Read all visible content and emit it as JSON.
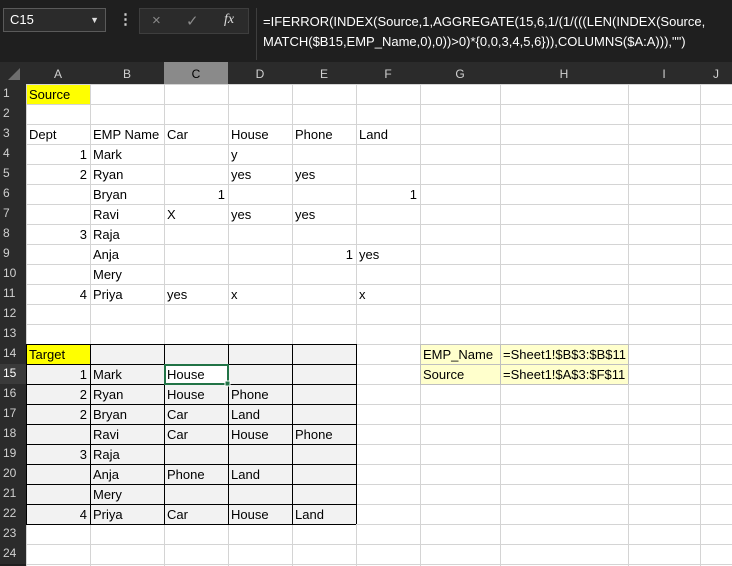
{
  "name_box": {
    "value": "C15"
  },
  "formula_bar": {
    "cancel_icon": "×",
    "enter_icon": "✓",
    "fx_icon": "fx",
    "formula": "=IFERROR(INDEX(Source,1,AGGREGATE(15,6,1/(1/(((LEN(INDEX(Source,\nMATCH($B15,EMP_Name,0),0))>0)*{0,0,3,4,5,6})),COLUMNS($A:A))),\"\")"
  },
  "columns": [
    "A",
    "B",
    "C",
    "D",
    "E",
    "F",
    "G",
    "H",
    "I",
    "J"
  ],
  "rows": [
    "1",
    "2",
    "3",
    "4",
    "5",
    "6",
    "7",
    "8",
    "9",
    "10",
    "11",
    "12",
    "13",
    "14",
    "15",
    "16",
    "17",
    "18",
    "19",
    "20",
    "21",
    "22",
    "23",
    "24"
  ],
  "selected_cell": "C15",
  "colors": {
    "yellow": "#ffff00",
    "light_yellow": "#ffffcc",
    "gray_fill": "#f2f2f2",
    "selection": "#217346"
  },
  "cells": {
    "A1": "Source",
    "A3": "Dept",
    "B3": "EMP Name",
    "C3": "Car",
    "D3": "House",
    "E3": "Phone",
    "F3": "Land",
    "A4": "1",
    "B4": "Mark",
    "D4": "y",
    "A5": "2",
    "B5": "Ryan",
    "D5": "yes",
    "E5": "yes",
    "B6": "Bryan",
    "C6": "1",
    "F6": "1",
    "B7": "Ravi",
    "C7": "X",
    "D7": "yes",
    "E7": "yes",
    "A8": "3",
    "B8": "Raja",
    "B9": "Anja",
    "E9": "1",
    "F9": "yes",
    "B10": "Mery",
    "A11": "4",
    "B11": "Priya",
    "C11": "yes",
    "D11": "x",
    "F11": "x",
    "A14": "Target",
    "A15": "1",
    "B15": "Mark",
    "C15": "House",
    "A16": "2",
    "B16": "Ryan",
    "C16": "House",
    "D16": "Phone",
    "A17": "2",
    "B17": "Bryan",
    "C17": "Car",
    "D17": "Land",
    "B18": "Ravi",
    "C18": "Car",
    "D18": "House",
    "E18": "Phone",
    "A19": "3",
    "B19": "Raja",
    "B20": "Anja",
    "C20": "Phone",
    "D20": "Land",
    "B21": "Mery",
    "A22": "4",
    "B22": "Priya",
    "C22": "Car",
    "D22": "House",
    "E22": "Land",
    "G14": "EMP_Name",
    "H14": "=Sheet1!$B$3:$B$11",
    "G15": "Source",
    "H15": "=Sheet1!$A$3:$F$11"
  }
}
